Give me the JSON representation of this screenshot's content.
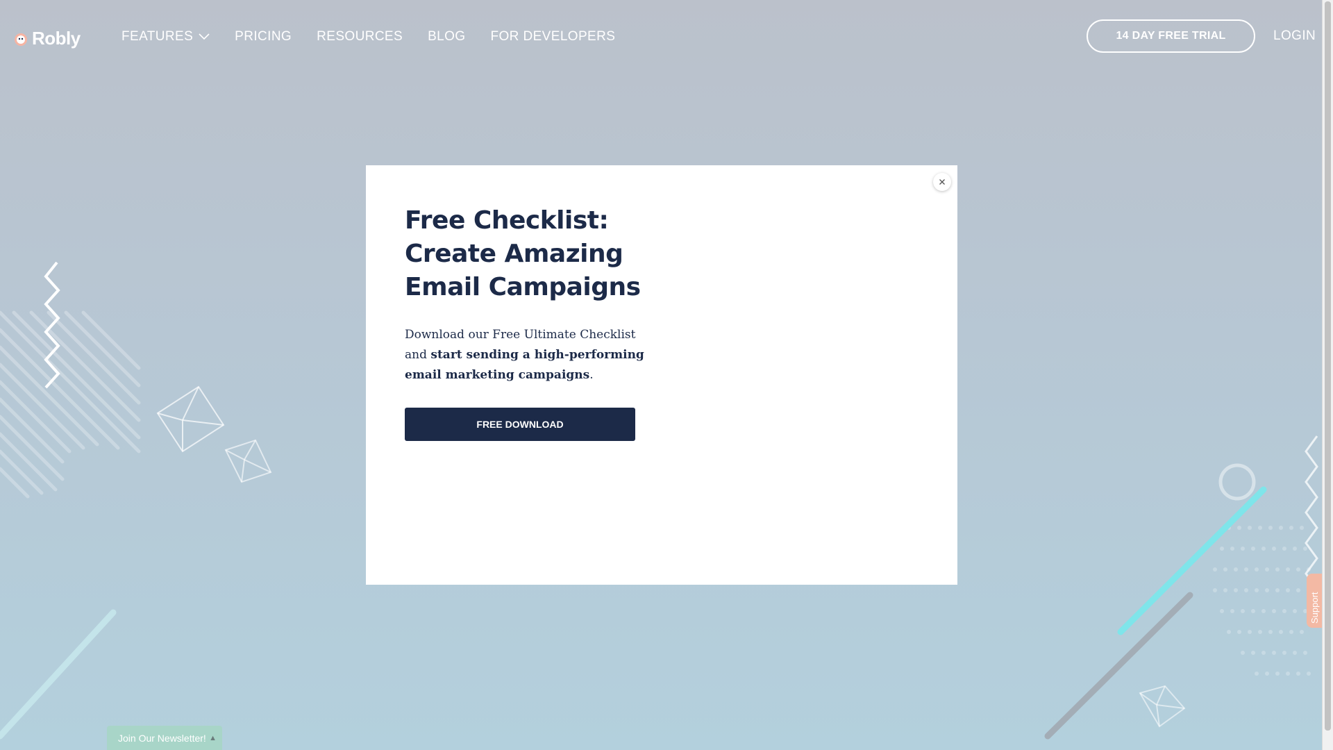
{
  "header": {
    "logo_text": "Robly",
    "nav": [
      {
        "label": "FEATURES",
        "has_dropdown": true
      },
      {
        "label": "PRICING"
      },
      {
        "label": "RESOURCES"
      },
      {
        "label": "BLOG"
      },
      {
        "label": "FOR DEVELOPERS"
      }
    ],
    "trial_button": "14 DAY FREE TRIAL",
    "login": "LOGIN"
  },
  "modal": {
    "title": "Free Checklist: Create Amazing Email Campaigns",
    "text_intro": "Download our Free Ultimate Checklist and ",
    "text_bold": "start sending a high-performing email marketing campaigns",
    "text_end": ".",
    "button": "FREE DOWNLOAD",
    "close_symbol": "×"
  },
  "newsletter": {
    "label": "Join Our Newsletter!",
    "arrow": "▲"
  },
  "support": {
    "label": "Support"
  },
  "colors": {
    "navy": "#1c2a48",
    "accent_cyan": "#7fe5ea",
    "newsletter_green": "#a8d5c8",
    "support_salmon": "#f3b9a4"
  }
}
